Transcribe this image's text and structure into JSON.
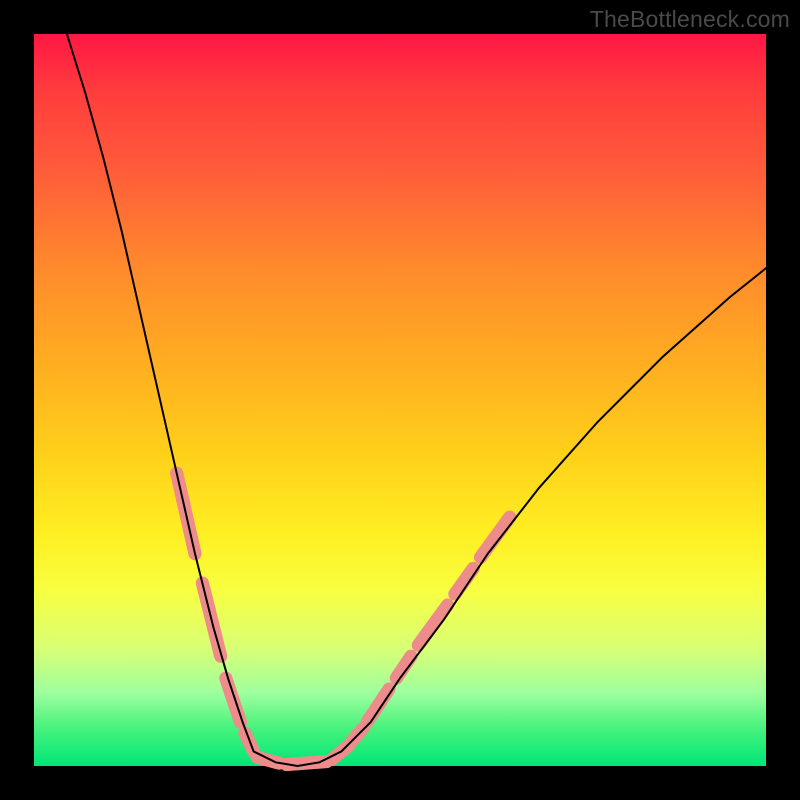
{
  "watermark": "TheBottleneck.com",
  "chart_data": {
    "type": "line",
    "title": "",
    "xlabel": "",
    "ylabel": "",
    "xlim": [
      0,
      1
    ],
    "ylim": [
      0,
      1
    ],
    "grid": false,
    "legend": false,
    "gradient_colors_top_to_bottom": [
      "#ff1744",
      "#ff3d3d",
      "#ff5a3a",
      "#ff8a2c",
      "#ffb020",
      "#ffd21a",
      "#ffee22",
      "#f7ff40",
      "#d8ff76",
      "#9eff9e",
      "#44f27c",
      "#00e676"
    ],
    "series": [
      {
        "name": "left-branch",
        "color": "#000000",
        "x": [
          0.045,
          0.07,
          0.095,
          0.12,
          0.145,
          0.17,
          0.195,
          0.22,
          0.245,
          0.265,
          0.285,
          0.3
        ],
        "y": [
          1.0,
          0.92,
          0.83,
          0.73,
          0.62,
          0.51,
          0.4,
          0.29,
          0.19,
          0.12,
          0.06,
          0.02
        ]
      },
      {
        "name": "flat-bottom",
        "color": "#000000",
        "x": [
          0.3,
          0.33,
          0.36,
          0.39,
          0.42
        ],
        "y": [
          0.02,
          0.005,
          0.0,
          0.005,
          0.02
        ]
      },
      {
        "name": "right-branch",
        "color": "#000000",
        "x": [
          0.42,
          0.46,
          0.5,
          0.56,
          0.62,
          0.69,
          0.77,
          0.86,
          0.95,
          1.0
        ],
        "y": [
          0.02,
          0.06,
          0.12,
          0.2,
          0.29,
          0.38,
          0.47,
          0.56,
          0.64,
          0.68
        ]
      }
    ],
    "highlight_segments": {
      "color": "#ee8b8b",
      "stroke_width_fraction": 0.018,
      "segments": [
        {
          "branch": "left",
          "x0": 0.195,
          "y0": 0.4,
          "x1": 0.22,
          "y1": 0.29
        },
        {
          "branch": "left",
          "x0": 0.23,
          "y0": 0.25,
          "x1": 0.255,
          "y1": 0.15
        },
        {
          "branch": "left",
          "x0": 0.262,
          "y0": 0.12,
          "x1": 0.282,
          "y1": 0.06
        },
        {
          "branch": "left",
          "x0": 0.288,
          "y0": 0.045,
          "x1": 0.3,
          "y1": 0.02
        },
        {
          "branch": "flat",
          "x0": 0.305,
          "y0": 0.012,
          "x1": 0.335,
          "y1": 0.004
        },
        {
          "branch": "flat",
          "x0": 0.345,
          "y0": 0.002,
          "x1": 0.4,
          "y1": 0.006
        },
        {
          "branch": "flat",
          "x0": 0.408,
          "y0": 0.01,
          "x1": 0.43,
          "y1": 0.028
        },
        {
          "branch": "right",
          "x0": 0.435,
          "y0": 0.035,
          "x1": 0.45,
          "y1": 0.052
        },
        {
          "branch": "right",
          "x0": 0.455,
          "y0": 0.06,
          "x1": 0.485,
          "y1": 0.105
        },
        {
          "branch": "right",
          "x0": 0.495,
          "y0": 0.12,
          "x1": 0.515,
          "y1": 0.15
        },
        {
          "branch": "right",
          "x0": 0.525,
          "y0": 0.165,
          "x1": 0.565,
          "y1": 0.22
        },
        {
          "branch": "right",
          "x0": 0.575,
          "y0": 0.235,
          "x1": 0.6,
          "y1": 0.27
        },
        {
          "branch": "right",
          "x0": 0.61,
          "y0": 0.285,
          "x1": 0.65,
          "y1": 0.34
        }
      ]
    }
  }
}
